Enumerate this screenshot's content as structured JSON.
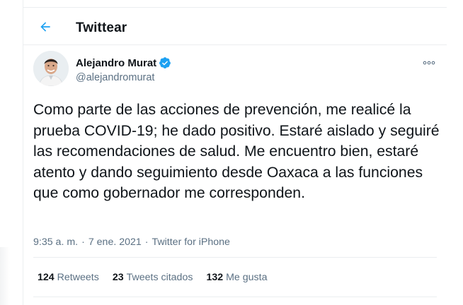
{
  "header": {
    "title": "Twittear",
    "back_icon": "arrow-left-icon"
  },
  "author": {
    "name": "Alejandro Murat",
    "handle": "@alejandromurat",
    "verified": true,
    "avatar_icon": "user-avatar"
  },
  "tweet": {
    "text": "Como parte de las acciones de prevención, me realicé la prueba COVID-19; he dado positivo. Estaré aislado y seguiré las recomendaciones de salud. Me encuentro bien, estaré atento y dando seguimiento desde Oaxaca a las funciones que como gobernador me corresponden.",
    "time": "9:35 a. m.",
    "separator": "·",
    "date": "7 ene. 2021",
    "source": "Twitter for iPhone"
  },
  "stats": {
    "retweets": {
      "count": "124",
      "label": "Retweets"
    },
    "quotes": {
      "count": "23",
      "label": "Tweets citados"
    },
    "likes": {
      "count": "132",
      "label": "Me gusta"
    }
  },
  "colors": {
    "accent": "#1da1f2",
    "muted": "#5b7083",
    "text": "#0f1419",
    "border": "#ebeef0"
  }
}
